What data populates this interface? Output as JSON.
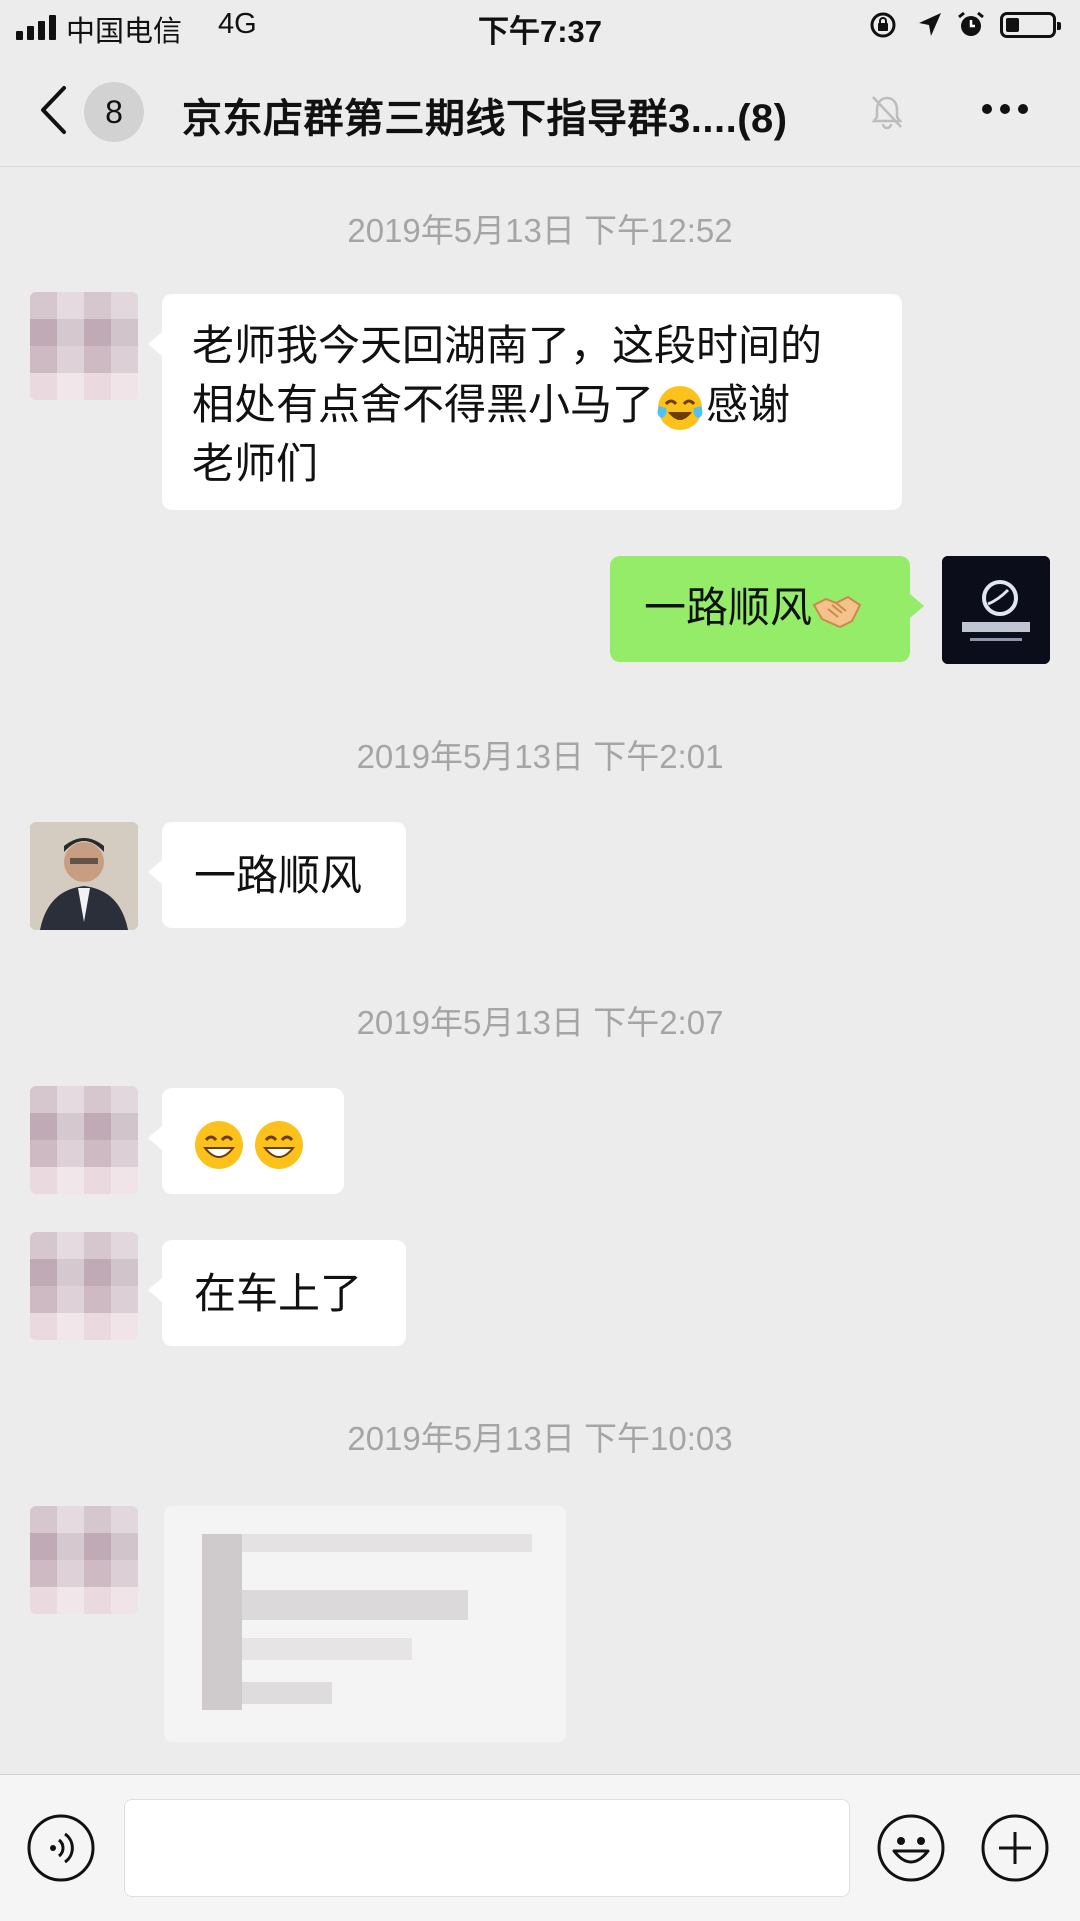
{
  "status_bar": {
    "carrier": "中国电信",
    "network": "4G",
    "time": "下午7:37",
    "battery_level": 0.3
  },
  "nav": {
    "unread_count": "8",
    "title": "京东店群第三期线下指导群3....(8)",
    "icons": [
      "back-icon",
      "mute-bell-icon",
      "more-icon"
    ]
  },
  "timestamps": [
    "2019年5月13日 下午12:52",
    "2019年5月13日 下午2:01",
    "2019年5月13日 下午2:07",
    "2019年5月13日 下午10:03"
  ],
  "messages": {
    "m1": {
      "line1": "老师我今天回湖南了，这段时间的",
      "line2_a": "相处有点舍不得黑小马了",
      "line2_emoji": "tears-of-joy-emoji",
      "line2_b": "感谢",
      "line3": "老师们"
    },
    "m2": {
      "text": "一路顺风",
      "emoji": "handshake-emoji",
      "avatar_logo_text": "黑小马电商"
    },
    "m3": {
      "text": "一路顺风"
    },
    "m4": {
      "emojis": [
        "grinning-emoji",
        "grinning-emoji"
      ]
    },
    "m5": {
      "text": "在车上了"
    },
    "m6": {
      "content": "blurred image"
    }
  },
  "input_bar": {
    "value": "",
    "icons": [
      "voice-icon",
      "emoji-icon",
      "plus-icon"
    ]
  },
  "colors": {
    "background": "#ececec",
    "bubble_incoming": "#ffffff",
    "bubble_outgoing": "#95ec69",
    "timestamp": "#a5a5a5"
  }
}
